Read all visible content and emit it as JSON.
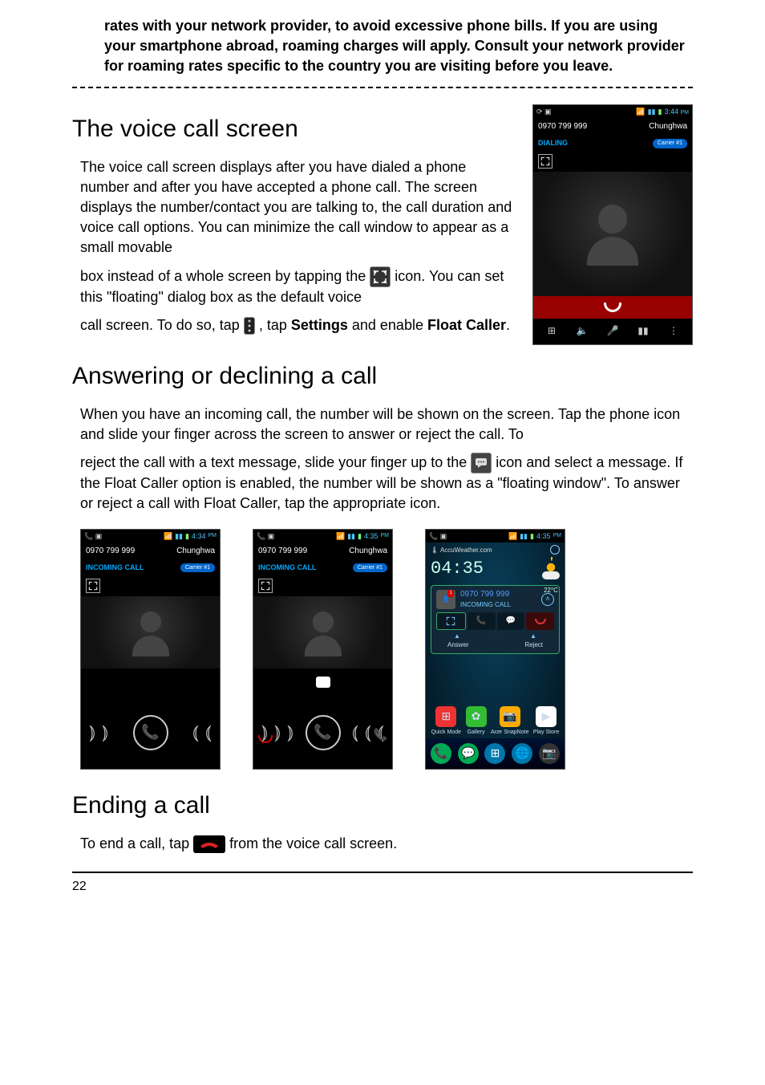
{
  "warning_text": "rates with your network provider, to avoid excessive phone bills. If you are using your smartphone abroad, roaming charges will apply. Consult your network provider for roaming rates specific to the country you are visiting before you leave.",
  "section_voice": {
    "heading": "The voice call screen",
    "para1": "The voice call screen displays after you have dialed a phone number and after you have accepted a phone call. The screen displays the number/contact you are talking to, the call duration and voice call options. You can minimize the call window to appear as a small movable",
    "para2_a": "box instead of a whole screen by tapping the ",
    "para2_b": " icon. You can set this \"floating\" dialog box as the default voice",
    "para3_a": "call screen. To do so, tap ",
    "para3_b": ", tap ",
    "settings_word": "Settings",
    "para3_c": " and enable ",
    "float_caller": "Float Caller",
    "para3_d": "."
  },
  "section_answer": {
    "heading": "Answering or declining a call",
    "para1": "When you have an incoming call, the number will be shown on the screen. Tap the phone icon and slide your finger across the screen to answer or reject the call. To",
    "para2_a": "reject the call with a text message, slide your finger up to the ",
    "para2_b": " icon and select a message. If the Float Caller option is enabled, the number will be shown as a \"floating window\". To answer or reject a call with Float Caller, tap the appropriate icon."
  },
  "section_end": {
    "heading": "Ending a call",
    "para_a": "To end a call, tap ",
    "para_b": " from the voice call screen."
  },
  "phone_common": {
    "number": "0970 799 999",
    "contact": "Chunghwa",
    "carrier": "Carrier #1"
  },
  "phone_dialing": {
    "time": "3:44",
    "ampm": "PM",
    "state": "DIALING"
  },
  "phone_incoming1": {
    "time": "4:34",
    "ampm": "PM",
    "state": "INCOMING CALL"
  },
  "phone_incoming2": {
    "time": "4:35",
    "ampm": "PM",
    "state": "INCOMING CALL"
  },
  "phone_float": {
    "time": "4:35",
    "ampm": "PM",
    "accu": "AccuWeather.com",
    "clock": "04:35",
    "temp": "22°C",
    "state": "INCOMING CALL",
    "answer": "Answer",
    "reject": "Reject",
    "apps": {
      "a1": "Quick Mode",
      "a2": "Gallery",
      "a3": "Acer SnapNote",
      "a4": "Play Store"
    }
  },
  "page_number": "22"
}
